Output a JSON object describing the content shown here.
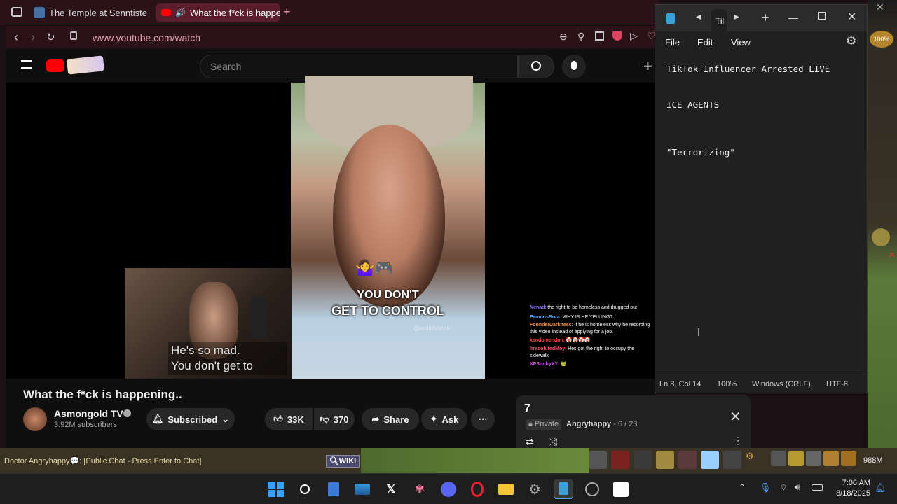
{
  "browser": {
    "tabs": [
      {
        "label": "The Temple at Senntisten"
      },
      {
        "label": "What the f*ck is happe"
      }
    ],
    "url": "www.youtube.com/watch"
  },
  "youtube": {
    "search_placeholder": "Search",
    "video_caption_1": "YOU DON'T",
    "video_caption_2": "GET TO CONTROL",
    "watermark": "@amishocks",
    "subtitle_line1": "He's so mad.",
    "subtitle_line2": "You don't get to",
    "chat": [
      {
        "user": "Nenad",
        "msg": "the right to be homeless and drugged out"
      },
      {
        "user": "FamousBora",
        "msg": "WHY IS HE YELLING?"
      },
      {
        "user": "FounderDarkness",
        "msg": "If he is homeless why he recording this video instead of applying for a job."
      },
      {
        "user": "kendomendoh",
        "msg": "🤡🤡🤡🤡"
      },
      {
        "user": "IrresolutedMoy",
        "msg": "Hes got the right to occupy the sidewalk"
      },
      {
        "user": "XPSnobyXY",
        "msg": "🐸"
      }
    ],
    "title": "What the f*ck is happening..",
    "channel": "Asmongold TV",
    "subscribers": "3.92M subscribers",
    "subscribed_label": "Subscribed",
    "likes": "33K",
    "dislikes": "370",
    "share_label": "Share",
    "ask_label": "Ask"
  },
  "playlist": {
    "title": "7",
    "privacy": "Private",
    "owner": "Angryhappy",
    "position": "- 6 / 23"
  },
  "notepad": {
    "tab_title": "Til",
    "menu": [
      "File",
      "Edit",
      "View"
    ],
    "lines": [
      "TikTok Influencer Arrested LIVE",
      "",
      "",
      "ICE AGENTS",
      "",
      "",
      "",
      "\"Terrorizing\""
    ],
    "status_pos": "Ln 8, Col 14",
    "status_zoom": "100%",
    "status_eol": "Windows (CRLF)",
    "status_enc": "UTF-8"
  },
  "game": {
    "chat_line": "Doctor  Angryhappy💬: [Public Chat - Press Enter to Chat]",
    "wiki_label": "WIKI",
    "memory": "988M",
    "zoom_badge": "100%"
  },
  "taskbar": {
    "time": "7:06 AM",
    "date": "8/18/2025"
  },
  "colors": {
    "browser_bg": "#2a1218",
    "active_tab": "#5a1d2b",
    "youtube_red": "#ff0000",
    "notepad_bg": "#202020"
  }
}
